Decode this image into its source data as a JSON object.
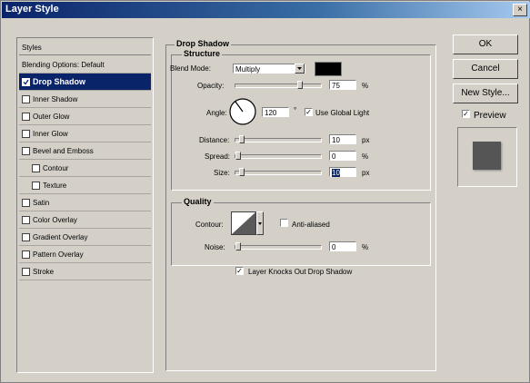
{
  "window": {
    "title": "Layer Style",
    "close": "×"
  },
  "sidebar": {
    "header": "Styles",
    "blending": "Blending Options: Default",
    "items": [
      {
        "label": "Drop Shadow",
        "checked": true
      },
      {
        "label": "Inner Shadow",
        "checked": false
      },
      {
        "label": "Outer Glow",
        "checked": false
      },
      {
        "label": "Inner Glow",
        "checked": false
      },
      {
        "label": "Bevel and Emboss",
        "checked": false
      },
      {
        "label": "Contour",
        "checked": false
      },
      {
        "label": "Texture",
        "checked": false
      },
      {
        "label": "Satin",
        "checked": false
      },
      {
        "label": "Color Overlay",
        "checked": false
      },
      {
        "label": "Gradient Overlay",
        "checked": false
      },
      {
        "label": "Pattern Overlay",
        "checked": false
      },
      {
        "label": "Stroke",
        "checked": false
      }
    ]
  },
  "drop_shadow": {
    "section_title": "Drop Shadow",
    "structure_title": "Structure",
    "blend_mode_label": "Blend Mode:",
    "blend_mode_value": "Multiply",
    "opacity_label": "Opacity:",
    "opacity_value": "75",
    "opacity_unit": "%",
    "angle_label": "Angle:",
    "angle_value": "120",
    "angle_unit": "°",
    "global_light_label": "Use Global Light",
    "distance_label": "Distance:",
    "distance_value": "10",
    "distance_unit": "px",
    "spread_label": "Spread:",
    "spread_value": "0",
    "spread_unit": "%",
    "size_label": "Size:",
    "size_value": "10",
    "size_unit": "px",
    "shadow_color": "#000000"
  },
  "quality": {
    "title": "Quality",
    "contour_label": "Contour:",
    "anti_aliased_label": "Anti-aliased",
    "noise_label": "Noise:",
    "noise_value": "0",
    "noise_unit": "%",
    "knockout_label": "Layer Knocks Out Drop Shadow"
  },
  "buttons": {
    "ok": "OK",
    "cancel": "Cancel",
    "new_style": "New Style...",
    "preview": "Preview"
  },
  "colors": {
    "title_bar": "#0a246a",
    "selection": "#0a246a",
    "preview_swatch": "#555555"
  }
}
